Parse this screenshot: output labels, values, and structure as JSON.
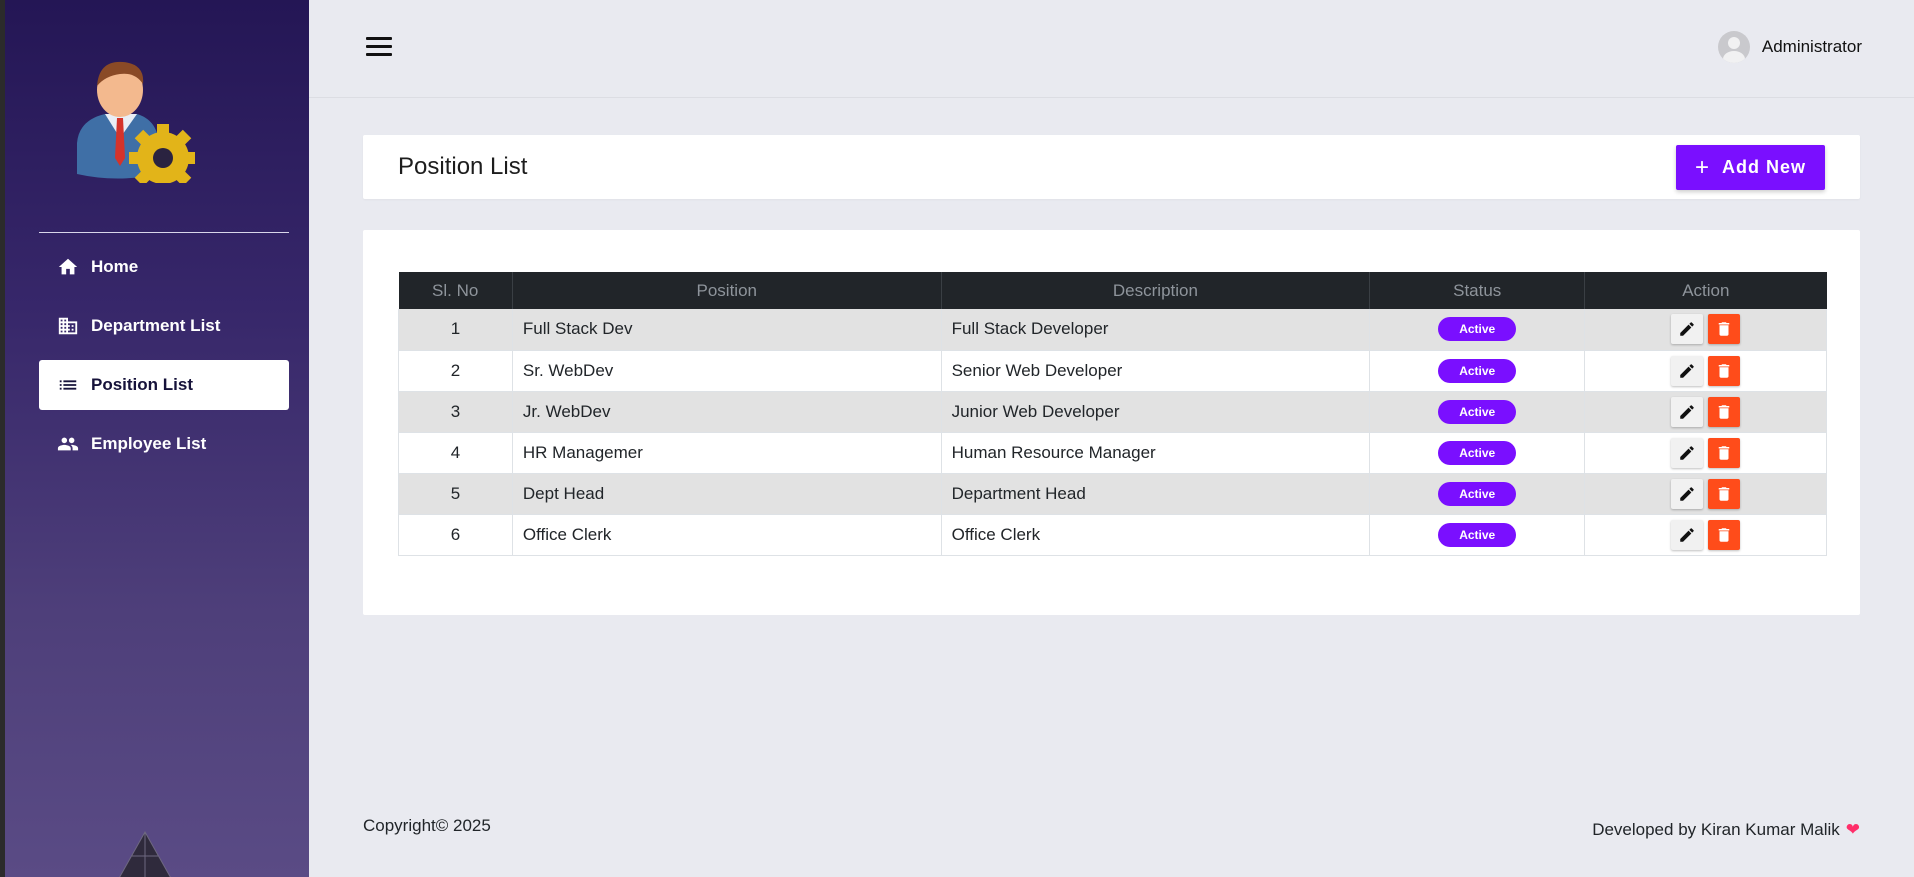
{
  "sidebar": {
    "items": [
      {
        "label": "Home",
        "icon": "home-icon",
        "active": false
      },
      {
        "label": "Department List",
        "icon": "building-icon",
        "active": false
      },
      {
        "label": "Position List",
        "icon": "list-icon",
        "active": true
      },
      {
        "label": "Employee List",
        "icon": "people-icon",
        "active": false
      }
    ]
  },
  "topbar": {
    "user_name": "Administrator"
  },
  "header": {
    "title": "Position List",
    "add_button_label": "Add New"
  },
  "table": {
    "columns": [
      "Sl. No",
      "Position",
      "Description",
      "Status",
      "Action"
    ],
    "rows": [
      {
        "sl": "1",
        "position": "Full Stack Dev",
        "description": "Full Stack Developer",
        "status": "Active"
      },
      {
        "sl": "2",
        "position": "Sr. WebDev",
        "description": "Senior Web Developer",
        "status": "Active"
      },
      {
        "sl": "3",
        "position": "Jr. WebDev",
        "description": "Junior Web Developer",
        "status": "Active"
      },
      {
        "sl": "4",
        "position": "HR Managemer",
        "description": "Human Resource Manager",
        "status": "Active"
      },
      {
        "sl": "5",
        "position": "Dept Head",
        "description": "Department Head",
        "status": "Active"
      },
      {
        "sl": "6",
        "position": "Office Clerk",
        "description": "Office Clerk",
        "status": "Active"
      }
    ]
  },
  "footer": {
    "copyright": "Copyright© 2025",
    "developer": "Developed by Kiran Kumar Malik"
  },
  "colors": {
    "accent": "#7a0fff",
    "delete": "#ff4c1a",
    "sidebar_top": "#241655",
    "table_header": "#212529"
  }
}
